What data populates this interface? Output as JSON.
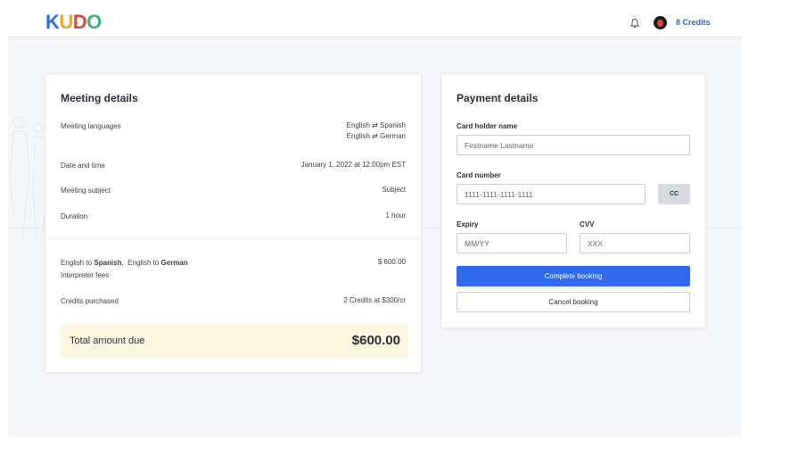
{
  "header": {
    "logo_letters": [
      {
        "char": "K",
        "color": "#2f6bec"
      },
      {
        "char": "U",
        "color": "#f0a62a"
      },
      {
        "char": "D",
        "color": "#e0463c"
      },
      {
        "char": "O",
        "color": "#3fb27f"
      }
    ],
    "bell_icon": "bell-icon",
    "credits_label": "8 Credits"
  },
  "meeting": {
    "title": "Meeting details",
    "languages_label": "Meeting languages",
    "language_pairs": [
      {
        "from": "English",
        "arrow": "⇄",
        "to": "Spanish"
      },
      {
        "from": "English",
        "arrow": "⇄",
        "to": "German"
      }
    ],
    "datetime_label": "Date and time",
    "datetime_value": "January 1, 2022 at 12:00pm EST",
    "subject_label": "Meeting subject",
    "subject_value": "Subject",
    "duration_label": "Duration",
    "duration_value": "1 hour",
    "fees_line": {
      "prefix1": "English to ",
      "lang1": "Spanish",
      "sep": ",  ",
      "prefix2": "English to ",
      "lang2": "German"
    },
    "fees_label": "Interpreter fees",
    "fees_value": "$ 600.00",
    "credits_label": "Credits purchased",
    "credits_value": "2 Credits at $300/cr",
    "total_label": "Total amount due",
    "total_value": "$600.00"
  },
  "payment": {
    "title": "Payment details",
    "holder_label": "Card holder name",
    "holder_placeholder": "Firstname Lastname",
    "number_label": "Card number",
    "number_placeholder": "1111-1111-1111-1111",
    "cc_label": "CC",
    "expiry_label": "Expiry",
    "expiry_placeholder": "MM/YY",
    "cvv_label": "CVV",
    "cvv_placeholder": "XXX",
    "complete_label": "Complete booking",
    "cancel_label": "Cancel booking"
  },
  "colors": {
    "accent": "#2f6bec",
    "total_bg": "#fdf7df"
  }
}
